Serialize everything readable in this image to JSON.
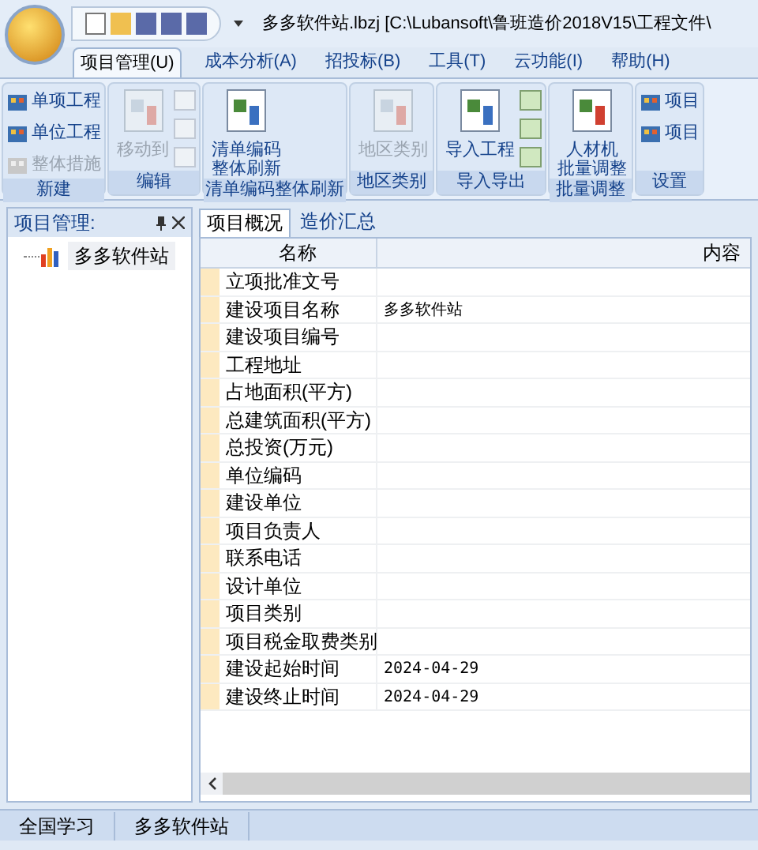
{
  "window": {
    "title": "多多软件站.lbzj [C:\\Lubansoft\\鲁班造价2018V15\\工程文件\\"
  },
  "menu_tabs": [
    {
      "label": "项目管理(U)",
      "selected": true
    },
    {
      "label": "成本分析(A)",
      "selected": false
    },
    {
      "label": "招投标(B)",
      "selected": false
    },
    {
      "label": "工具(T)",
      "selected": false
    },
    {
      "label": "云功能(I)",
      "selected": false
    },
    {
      "label": "帮助(H)",
      "selected": false
    }
  ],
  "ribbon": [
    {
      "label": "新建",
      "items": [
        {
          "kind": "small",
          "label": "单项工程",
          "disabled": false
        },
        {
          "kind": "small",
          "label": "单位工程",
          "disabled": false
        },
        {
          "kind": "small",
          "label": "整体措施",
          "disabled": true
        }
      ]
    },
    {
      "label": "编辑",
      "items": [
        {
          "kind": "large",
          "lines": [
            "移动到"
          ],
          "disabled": true
        },
        {
          "kind": "iconcol",
          "disabled": true
        }
      ]
    },
    {
      "label": "清单编码整体刷新",
      "items": [
        {
          "kind": "large",
          "lines": [
            "清单编码",
            "整体刷新"
          ],
          "disabled": false
        }
      ]
    },
    {
      "label": "地区类别",
      "items": [
        {
          "kind": "large",
          "lines": [
            "地区类别"
          ],
          "disabled": true
        }
      ]
    },
    {
      "label": "导入导出",
      "items": [
        {
          "kind": "large",
          "lines": [
            "导入工程"
          ],
          "disabled": false
        },
        {
          "kind": "iconcol",
          "disabled": false
        }
      ]
    },
    {
      "label": "批量调整",
      "items": [
        {
          "kind": "large",
          "lines": [
            "人材机",
            "批量调整"
          ],
          "disabled": false
        }
      ]
    },
    {
      "label": "设置",
      "items": [
        {
          "kind": "small",
          "label": "项目",
          "disabled": false
        },
        {
          "kind": "small",
          "label": "项目",
          "disabled": false
        }
      ]
    }
  ],
  "side_panel": {
    "title": "项目管理:",
    "tree": [
      {
        "label": "多多软件站",
        "selected": true
      }
    ]
  },
  "doc_tabs": [
    {
      "label": "项目概况",
      "selected": true
    },
    {
      "label": "造价汇总",
      "selected": false
    }
  ],
  "table": {
    "columns": [
      "名称",
      "内容"
    ],
    "rows": [
      [
        "立项批准文号",
        ""
      ],
      [
        "建设项目名称",
        "多多软件站"
      ],
      [
        "建设项目编号",
        ""
      ],
      [
        "工程地址",
        ""
      ],
      [
        "占地面积(平方)",
        ""
      ],
      [
        "总建筑面积(平方)",
        ""
      ],
      [
        "总投资(万元)",
        ""
      ],
      [
        "单位编码",
        ""
      ],
      [
        "建设单位",
        ""
      ],
      [
        "项目负责人",
        ""
      ],
      [
        "联系电话",
        ""
      ],
      [
        "设计单位",
        ""
      ],
      [
        "项目类别",
        ""
      ],
      [
        "项目税金取费类别",
        ""
      ],
      [
        "建设起始时间",
        "2024-04-29"
      ],
      [
        "建设终止时间",
        "2024-04-29"
      ]
    ]
  },
  "status_bar": [
    "全国学习",
    "多多软件站"
  ]
}
